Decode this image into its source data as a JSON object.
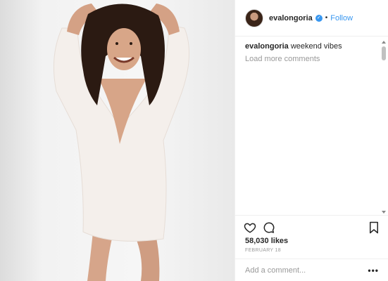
{
  "post": {
    "image_icon": "photo-of-woman",
    "author": {
      "username": "evalongoria",
      "verified_icon": "verified-badge-icon",
      "separator": "•",
      "follow_label": "Follow"
    },
    "caption": {
      "username": "evalongoria",
      "text": "weekend vibes"
    },
    "load_more_label": "Load more comments",
    "likes_label": "58,030 likes",
    "date_label": "FEBRUARY 18",
    "comment_placeholder": "Add a comment...",
    "more_label": "•••",
    "colors": {
      "accent": "#3897f0",
      "muted": "#999999",
      "text": "#262626",
      "divider": "#efefef"
    }
  }
}
